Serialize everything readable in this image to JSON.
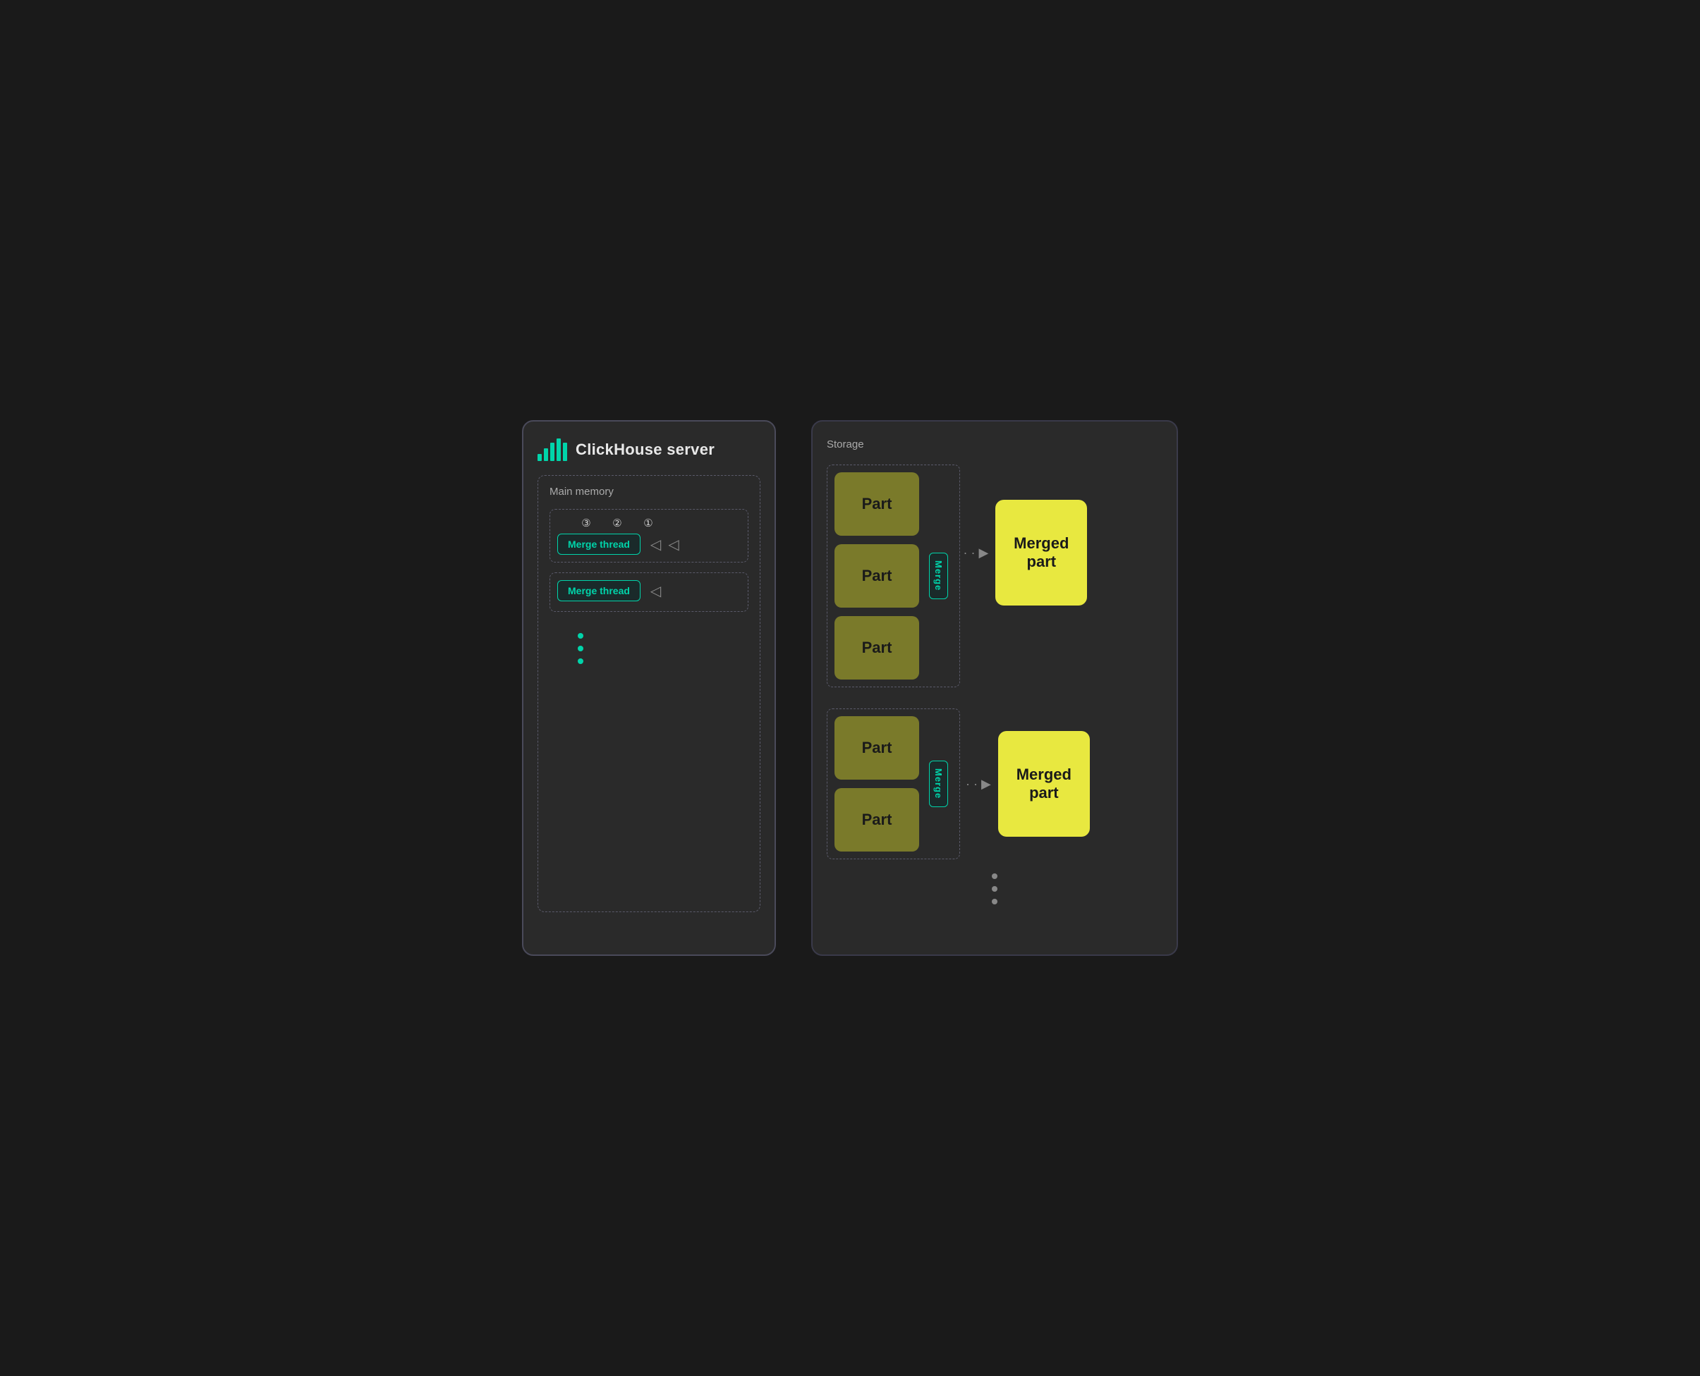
{
  "server": {
    "title": "ClickHouse server",
    "logo_bars": [
      4,
      8,
      12,
      16,
      12
    ],
    "main_memory": {
      "label": "Main memory",
      "merge_thread_1": {
        "steps": [
          "③",
          "②",
          "①"
        ],
        "label": "Merge thread"
      },
      "merge_thread_2": {
        "label": "Merge thread"
      },
      "dots": 3
    }
  },
  "storage": {
    "label": "Storage",
    "top_group": {
      "parts": [
        "Part",
        "Part",
        "Part"
      ],
      "merge_label": "Merge",
      "merged_label": "Merged\npart"
    },
    "bottom_group": {
      "parts": [
        "Part",
        "Part"
      ],
      "merge_label": "Merge",
      "merged_label": "Merged\npart"
    },
    "dots": 3
  }
}
